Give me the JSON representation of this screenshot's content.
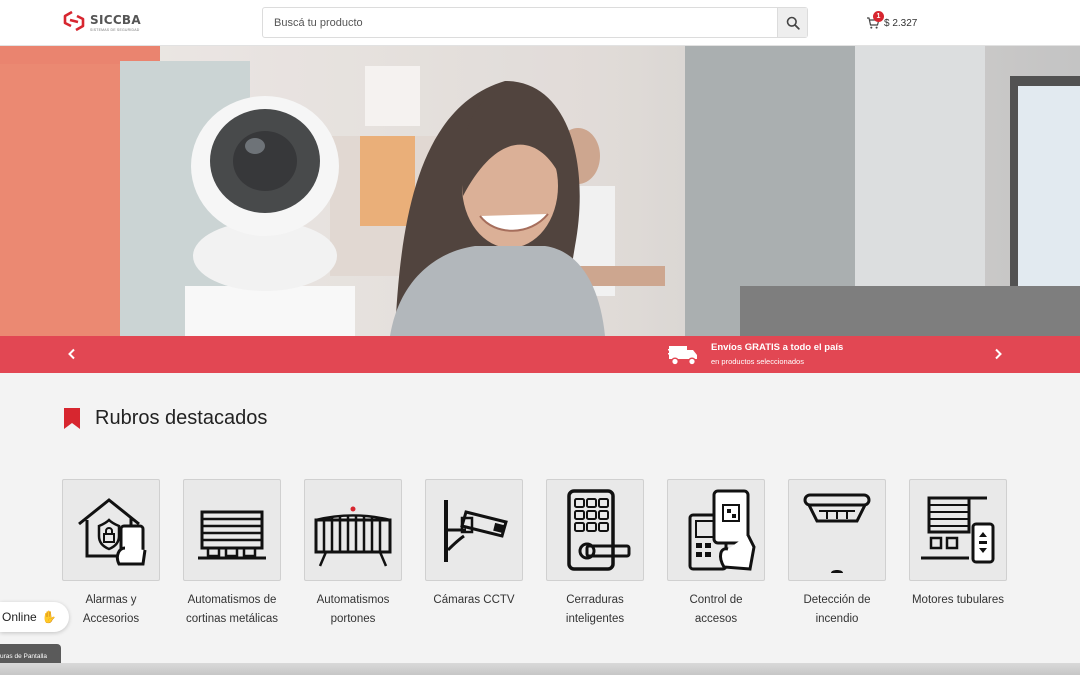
{
  "header": {
    "logo_name": "SICCBA",
    "logo_tagline": "SISTEMAS DE SEGURIDAD",
    "search_placeholder": "Buscá tu producto",
    "search_icon": "search-icon",
    "cart_icon": "shopping-cart-icon",
    "cart_count": "1",
    "cart_total": "$ 2.327"
  },
  "hero": {
    "prev_icon": "chevron-left-icon",
    "next_icon": "chevron-right-icon",
    "promo_icon": "delivery-truck-icon",
    "promo_title": "Envíos GRATIS a todo el país",
    "promo_subtitle": "en productos seleccionados",
    "bar_color": "#e24753"
  },
  "section": {
    "title": "Rubros destacados",
    "icon": "bookmark-icon",
    "accent": "#d7262f"
  },
  "categories": [
    {
      "label": "Alarmas y Accesorios",
      "icon": "house-alarm-phone-icon"
    },
    {
      "label": "Automatismos de cortinas metálicas",
      "icon": "rolling-shutter-icon"
    },
    {
      "label": "Automatismos portones",
      "icon": "gate-icon"
    },
    {
      "label": "Cámaras CCTV",
      "icon": "cctv-camera-icon"
    },
    {
      "label": "Cerraduras inteligentes",
      "icon": "smart-lock-icon"
    },
    {
      "label": "Control de accesos",
      "icon": "access-control-icon"
    },
    {
      "label": "Detección de incendio",
      "icon": "smoke-detector-icon"
    },
    {
      "label": "Motores tubulares",
      "icon": "tubular-motor-icon"
    }
  ],
  "widgets": {
    "online_label": "Online",
    "capture_label": "uras de Pantalla"
  }
}
